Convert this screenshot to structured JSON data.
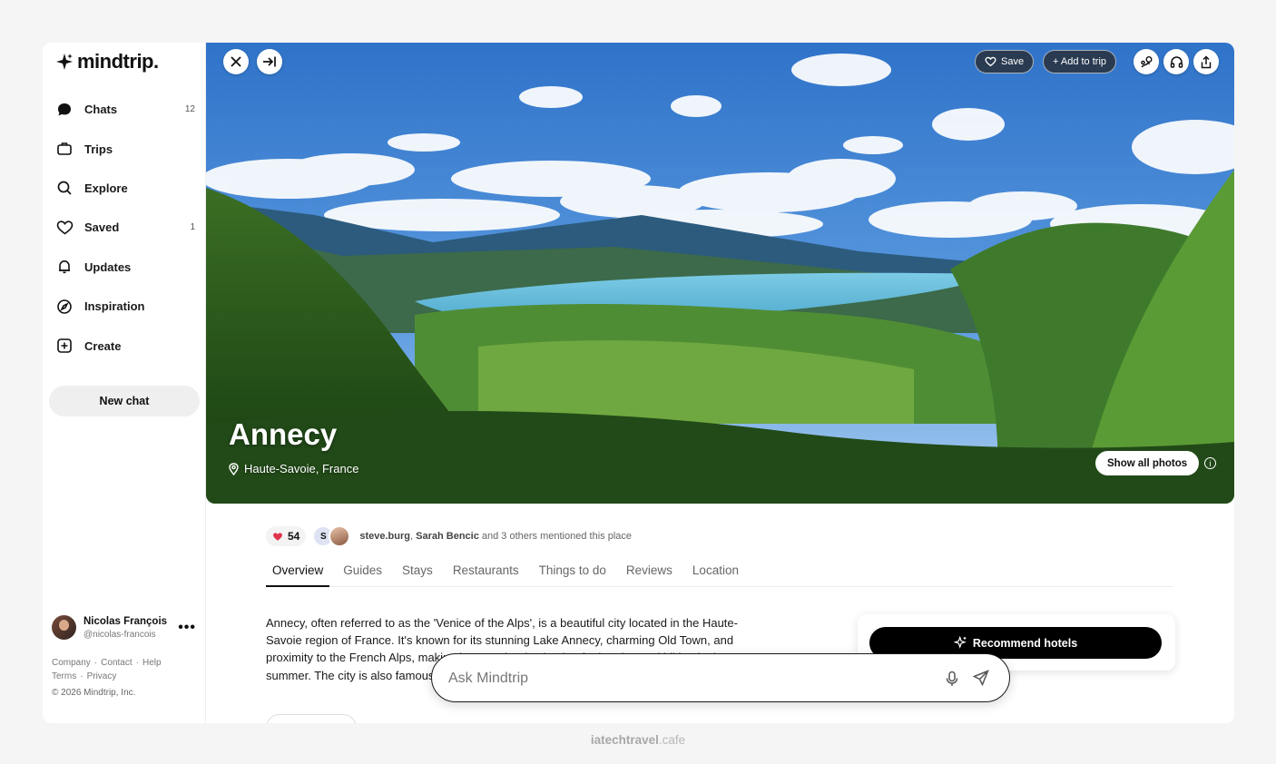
{
  "app": {
    "logo_text": "mindtrip."
  },
  "sidebar": {
    "items": [
      {
        "label": "Chats",
        "icon": "chat-bubble-icon",
        "count": "12"
      },
      {
        "label": "Trips",
        "icon": "suitcase-icon",
        "count": ""
      },
      {
        "label": "Explore",
        "icon": "search-icon",
        "count": ""
      },
      {
        "label": "Saved",
        "icon": "heart-icon",
        "count": "1"
      },
      {
        "label": "Updates",
        "icon": "bell-icon",
        "count": ""
      },
      {
        "label": "Inspiration",
        "icon": "compass-icon",
        "count": ""
      },
      {
        "label": "Create",
        "icon": "plus-square-icon",
        "count": ""
      }
    ],
    "new_chat_label": "New chat",
    "user": {
      "name": "Nicolas François",
      "handle": "@nicolas-francois"
    },
    "footer": {
      "company": "Company",
      "contact": "Contact",
      "help": "Help",
      "terms": "Terms",
      "privacy": "Privacy",
      "copyright": "© 2026 Mindtrip, Inc."
    }
  },
  "hero": {
    "save_label": "Save",
    "add_to_trip_label": "+ Add to trip",
    "title": "Annecy",
    "subtitle": "Haute-Savoie, France",
    "show_all_photos_label": "Show all photos"
  },
  "meta": {
    "likes": "54",
    "face_initial": "S",
    "mention_user1": "steve.burg",
    "mention_user2": "Sarah Bencic",
    "mention_rest": " and 3 others mentioned this place"
  },
  "tabs": [
    "Overview",
    "Guides",
    "Stays",
    "Restaurants",
    "Things to do",
    "Reviews",
    "Location"
  ],
  "description": "Annecy, often referred to as the 'Venice of the Alps', is a beautiful city located in the Haute-Savoie region of France. It's known for its stunning Lake Annecy, charming Old Town, and proximity to the French Alps, making it a popular destination for boating and hiking in the summer. The city is also famous for its local Savoyard cuisine and",
  "recommend_label": "Recommend hotels",
  "ask": {
    "placeholder": "Ask Mindtrip"
  },
  "watermark": {
    "main": "iatechtravel",
    "suffix": ".cafe"
  },
  "colors": {
    "accent": "#000000",
    "heart": "#e0334c",
    "lake": "#5fb6d6"
  }
}
